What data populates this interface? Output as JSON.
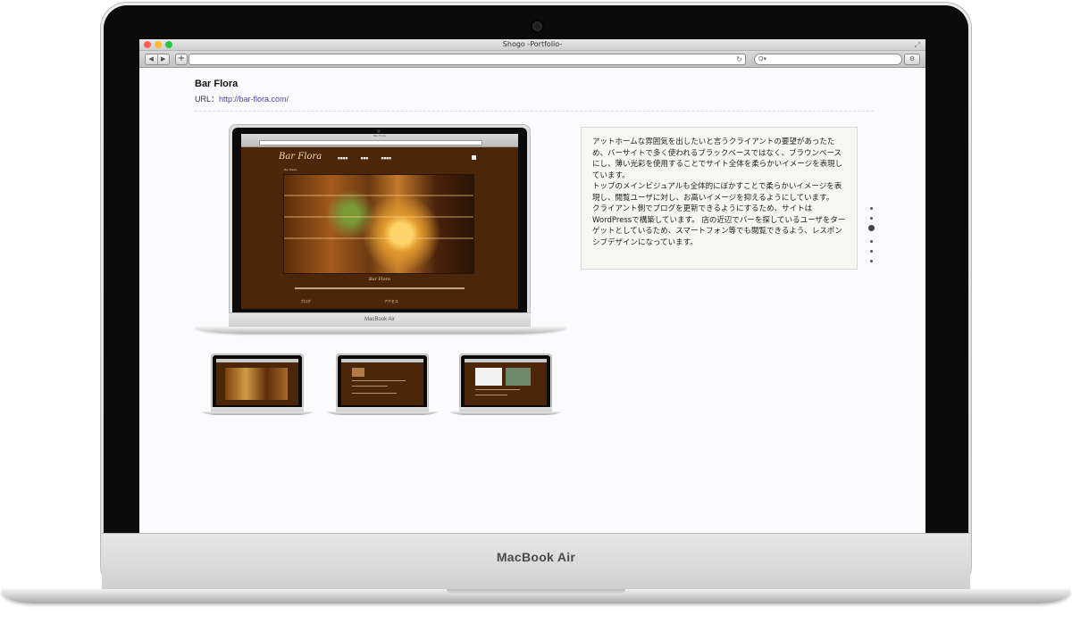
{
  "window": {
    "title": "Shogo -Portfolio-",
    "traffic_colors": [
      "#ff5f57",
      "#febc2e",
      "#28c840"
    ]
  },
  "toolbar": {
    "back_glyph": "◀",
    "forward_glyph": "▶",
    "new_tab_glyph": "+",
    "reload_glyph": "↻",
    "search_glyph": "Q▾",
    "settings_glyph": "⚙"
  },
  "laptop": {
    "brand": "MacBook Air"
  },
  "project": {
    "title": "Bar Flora",
    "url_label": "URL：",
    "url": "http://bar-flora.com/"
  },
  "mockup": {
    "site_logo": "Bar Flora",
    "nav": [
      "■■■■",
      "■■■",
      "■■■■"
    ],
    "news_label": "Bar News",
    "script_text": "Bar Flora",
    "footer_left": "ブログ",
    "footer_right": "アクセス",
    "device_label": "MacBook Air"
  },
  "description": [
    "アットホームな雰囲気を出したいと言うクライアントの要望があったため、バーサイトで多く使われるブラックベースではなく、ブラウンベースにし、薄い光彩を使用することでサイト全体を柔らかいイメージを表現しています。",
    "トップのメインビジュアルも全体的にぼかすことで柔らかいイメージを表現し、閲覧ユーザに対し、お高いイメージを抑えるようにしています。",
    "クライアント側でブログを更新できるようにするため、サイトはWordPressで構築しています。 店の近辺でバーを探しているユーザをターゲットとしているため、スマートフォン等でも閲覧できるよう、レスポンシブデザインになっています。"
  ],
  "pager": {
    "count": 6,
    "active_index": 2
  }
}
